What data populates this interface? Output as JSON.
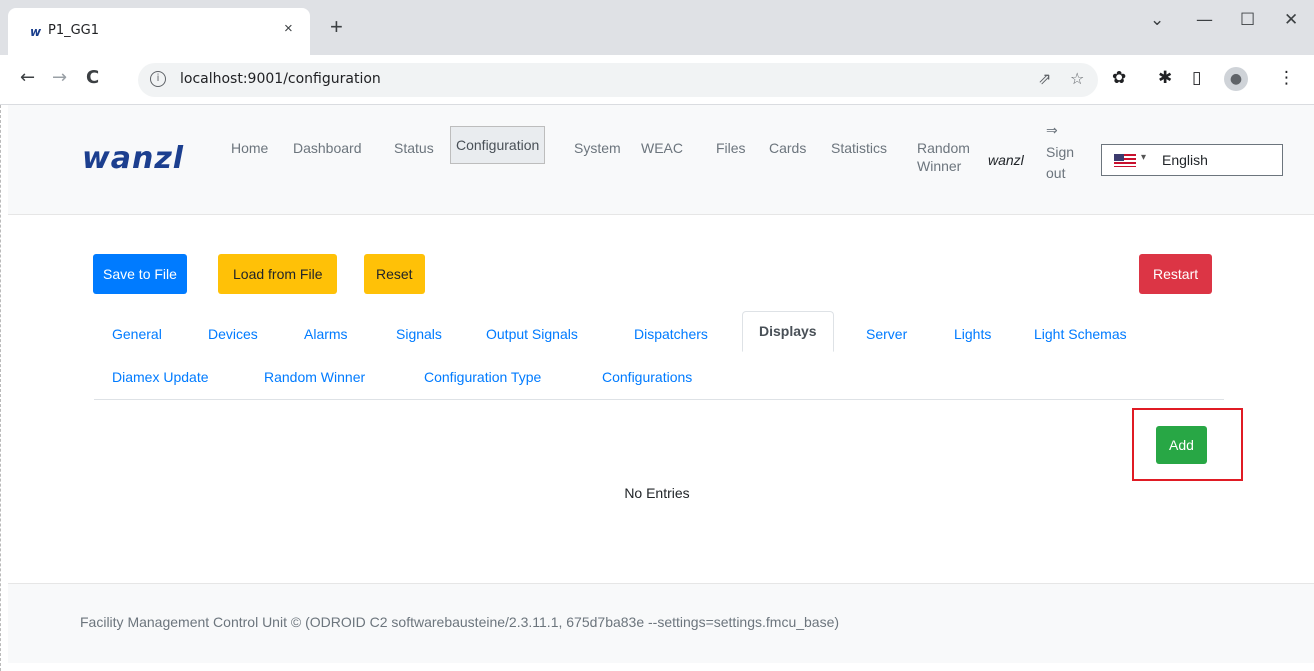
{
  "browser": {
    "tab_favicon": "w",
    "tab_title": "P1_GG1",
    "tab_close": "×",
    "new_tab": "+",
    "window_min": "—",
    "window_max": "☐",
    "window_close": "✕",
    "window_dropdown": "⌄",
    "back": "←",
    "forward": "→",
    "reload": "C",
    "url_info_icon": "i",
    "url": "localhost:9001/configuration",
    "share_icon": "⇗",
    "star_icon": "☆",
    "ext1_icon": "✿",
    "ext2_icon": "✱",
    "sidepanel_icon": "▯",
    "avatar_icon": "●",
    "menu_icon": "⋮"
  },
  "header": {
    "logo": "wanzl",
    "nav": [
      {
        "label": "Home"
      },
      {
        "label": "Dashboard"
      },
      {
        "label": "Status"
      },
      {
        "label": "Configuration"
      },
      {
        "label": "System"
      },
      {
        "label": "WEAC"
      },
      {
        "label": "Files"
      },
      {
        "label": "Cards"
      },
      {
        "label": "Statistics"
      },
      {
        "label": "Random",
        "label2": "Winner"
      }
    ],
    "user": "wanzl",
    "signout_icon": "⇒",
    "signout_line1": "Sign",
    "signout_line2": "out",
    "language": {
      "caret": "▾",
      "selected": "English"
    }
  },
  "actions": {
    "save": "Save to File",
    "load": "Load from File",
    "reset": "Reset",
    "restart": "Restart"
  },
  "config_tabs_row1": [
    "General",
    "Devices",
    "Alarms",
    "Signals",
    "Output Signals",
    "Dispatchers",
    "Displays",
    "Server",
    "Lights",
    "Light Schemas"
  ],
  "config_tabs_row2": [
    "Diamex Update",
    "Random Winner",
    "Configuration Type",
    "Configurations"
  ],
  "active_tab": "Displays",
  "content": {
    "add": "Add",
    "empty": "No Entries"
  },
  "footer": {
    "text": "Facility Management Control Unit © (ODROID C2 softwarebausteine/2.3.11.1, 675d7ba83e --settings=settings.fmcu_base)"
  },
  "colors": {
    "primary": "#007bff",
    "warning": "#ffc107",
    "danger": "#dc3545",
    "success": "#28a745",
    "logo": "#1c3f8f",
    "highlight": "#e01b24"
  }
}
